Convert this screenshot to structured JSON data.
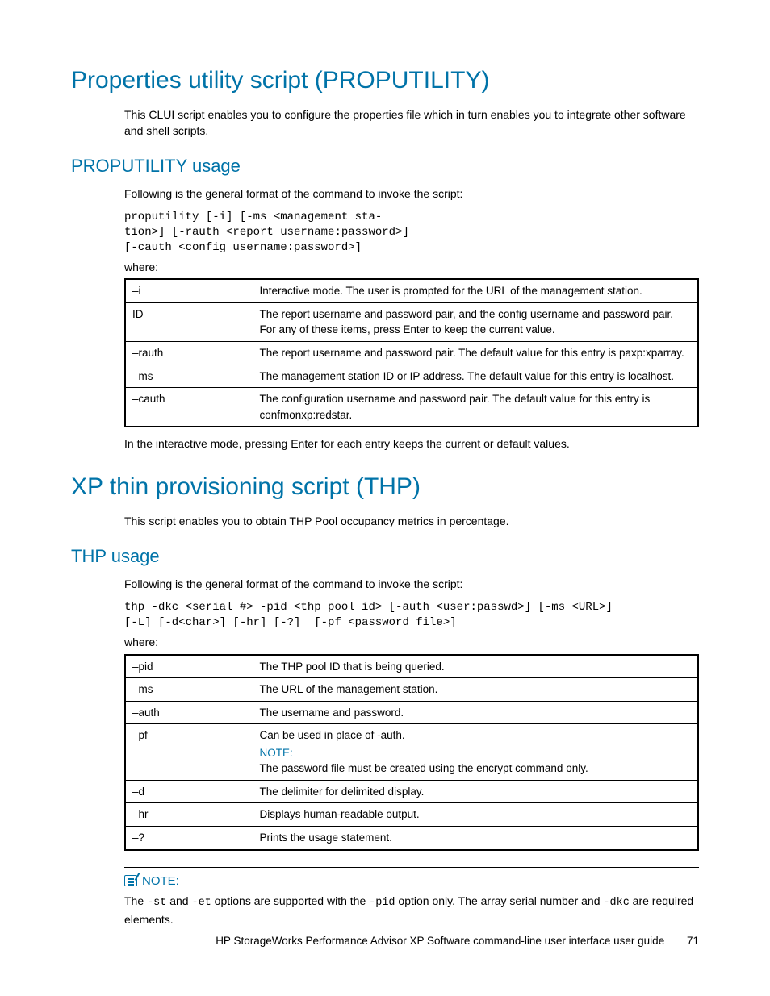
{
  "section1": {
    "heading": "Properties utility script (PROPUTILITY)",
    "intro": "This CLUI script enables you to configure the properties file which in turn enables you to integrate other software and shell scripts.",
    "sub_heading": "PROPUTILITY usage",
    "usage_intro": "Following is the general format of the command to invoke the script:",
    "code": "proputility [-i] [-ms <management sta-\ntion>] [-rauth <report username:password>]\n[-cauth <config username:password>]",
    "where_label": "where:",
    "table": [
      {
        "opt": "–i",
        "desc": "Interactive mode. The user is prompted for the URL of the management station."
      },
      {
        "opt": "ID",
        "desc": "The report username and password pair, and the config username and password pair. For any of these items, press Enter to keep the current value."
      },
      {
        "opt": "–rauth",
        "desc": "The report username and password pair. The default value for this entry is paxp:xparray."
      },
      {
        "opt": "–ms",
        "desc": "The management station ID or IP address. The default value for this entry is localhost."
      },
      {
        "opt": "–cauth",
        "desc": "The configuration username and password pair. The default value for this entry is confmonxp:redstar."
      }
    ],
    "after_table": "In the interactive mode, pressing Enter for each entry keeps the current or default values."
  },
  "section2": {
    "heading": "XP thin provisioning script (THP)",
    "intro": "This script enables you to obtain THP Pool occupancy metrics in percentage.",
    "sub_heading": "THP usage",
    "usage_intro": "Following is the general format of the command to invoke the script:",
    "code": "thp -dkc <serial #> -pid <thp pool id> [-auth <user:passwd>] [-ms <URL>]\n[-L] [-d<char>] [-hr] [-?]  [-pf <password file>]",
    "where_label": "where:",
    "table": [
      {
        "opt": "–pid",
        "desc": "The THP pool ID that is being queried."
      },
      {
        "opt": "–ms",
        "desc": "The URL of the management station."
      },
      {
        "opt": "–auth",
        "desc": "The username and password."
      },
      {
        "opt": "–pf",
        "desc_pre": "Can be used in place of -auth.",
        "note_head": "NOTE:",
        "desc_post": "The password file must be created using the encrypt command only."
      },
      {
        "opt": "–d",
        "desc": "The delimiter for delimited display."
      },
      {
        "opt": "–hr",
        "desc": "Displays human-readable output."
      },
      {
        "opt": "–?",
        "desc": "Prints the usage statement."
      }
    ]
  },
  "note": {
    "head": "NOTE:",
    "text_pre": "The ",
    "code1": "-st",
    "text_mid1": " and ",
    "code2": "-et",
    "text_mid2": " options are supported with the ",
    "code3": "-pid",
    "text_mid3": " option only. The array serial number and ",
    "code4": "-dkc",
    "text_post": " are required elements."
  },
  "footer": {
    "text": "HP StorageWorks Performance Advisor XP Software command-line user interface user guide",
    "page": "71"
  }
}
